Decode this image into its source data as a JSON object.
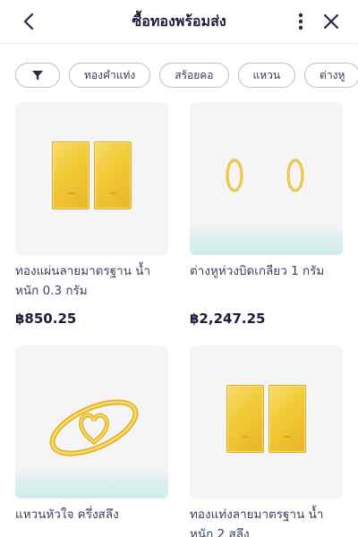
{
  "header": {
    "title": "ซื้อทองพร้อมส่ง",
    "back_icon": "chevron-left-icon",
    "more_icon": "more-vertical-icon",
    "close_icon": "close-icon"
  },
  "filters": {
    "filter_icon": "filter-funnel-icon",
    "chips": [
      "ทองคำแท่ง",
      "สร้อยคอ",
      "แหวน",
      "ต่างหู"
    ]
  },
  "products": [
    {
      "name": "ทองแผ่นลายมาตรฐาน น้ำหนัก 0.3 กรัม",
      "price": "฿850.25",
      "image": "gold-sheet-pair"
    },
    {
      "name": "ต่างหูห่วงบิดเกลียว 1 กรัม",
      "price": "฿2,247.25",
      "image": "gold-hoop-earrings"
    },
    {
      "name": "แหวนหัวใจ ครึ่งสลึง",
      "price": "",
      "image": "gold-heart-ring"
    },
    {
      "name": "ทองแท่งลายมาตรฐาน น้ำหนัก 2 สลึง",
      "price": "",
      "image": "gold-bar-pair"
    }
  ],
  "colors": {
    "gold": "#f2c935",
    "text_dark": "#1c1c3a",
    "card_bg": "#f5f5f6",
    "chip_border": "#bdbdc6"
  }
}
